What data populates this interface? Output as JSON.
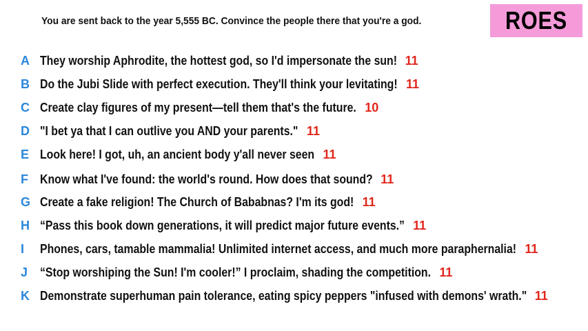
{
  "prompt": "You are sent back to the year 5,555 BC. Convince the people there that you're a god.",
  "badge": "ROES",
  "colors": {
    "letter": "#2b86d9",
    "score": "#e1261c",
    "badge_bg": "#f59bd9"
  },
  "answers": [
    {
      "letter": "A",
      "text": "They worship Aphrodite, the hottest god, so I'd impersonate the sun!",
      "score": "11"
    },
    {
      "letter": "B",
      "text": "Do the Jubi Slide with perfect execution. They'll think your levitating!",
      "score": "11"
    },
    {
      "letter": "C",
      "text": "Create clay figures of my present—tell them that's the future.",
      "score": "10"
    },
    {
      "letter": "D",
      "text": "\"I bet ya that I can outlive you AND your parents.\"",
      "score": "11"
    },
    {
      "letter": "E",
      "text": "Look here! I got, uh, an ancient body y'all never seen",
      "score": "11"
    },
    {
      "letter": "F",
      "text": "Know what I've found: the world's round. How does that sound?",
      "score": "11"
    },
    {
      "letter": "G",
      "text": "Create a fake religion! The Church of Bababnas? I'm its god!",
      "score": "11"
    },
    {
      "letter": "H",
      "text": "“Pass this book down generations, it will predict major future events.”",
      "score": "11"
    },
    {
      "letter": "I",
      "text": "Phones, cars, tamable mammalia! Unlimited internet access, and much more paraphernalia!",
      "score": "11"
    },
    {
      "letter": "J",
      "text": "“Stop worshiping the Sun! I'm cooler!” I proclaim, shading the competition.",
      "score": "11"
    },
    {
      "letter": "K",
      "text": "Demonstrate superhuman pain tolerance, eating spicy peppers \"infused with demons' wrath.\"",
      "score": "11"
    }
  ]
}
